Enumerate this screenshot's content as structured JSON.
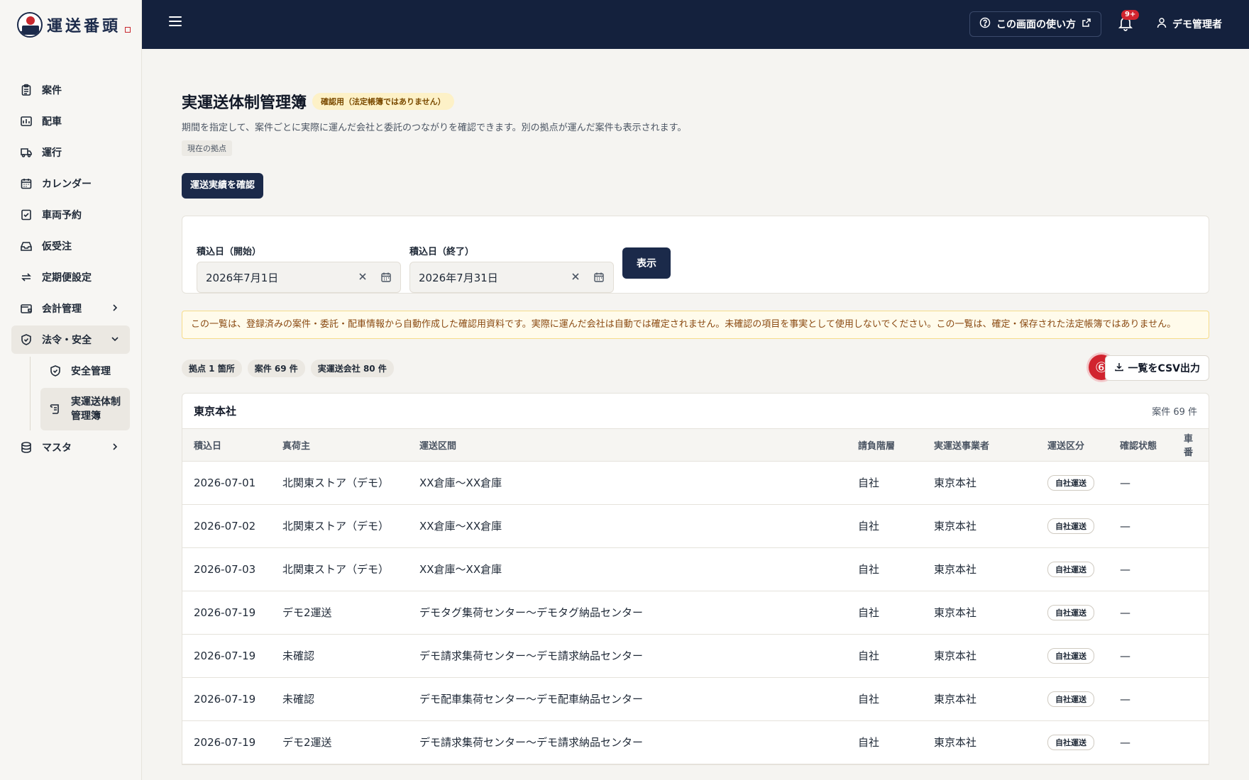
{
  "app": {
    "logo_text": "運送番頭"
  },
  "sidebar": {
    "items": [
      {
        "label": "案件",
        "icon": "clipboard-icon"
      },
      {
        "label": "配車",
        "icon": "chart-icon"
      },
      {
        "label": "運行",
        "icon": "truck-icon"
      },
      {
        "label": "カレンダー",
        "icon": "calendar-icon"
      },
      {
        "label": "車両予約",
        "icon": "check-calendar-icon"
      },
      {
        "label": "仮受注",
        "icon": "inbox-icon"
      },
      {
        "label": "定期便設定",
        "icon": "repeat-icon"
      },
      {
        "label": "会計管理",
        "icon": "wallet-icon"
      },
      {
        "label": "法令・安全",
        "icon": "shield-icon"
      },
      {
        "label": "マスタ",
        "icon": "database-icon"
      }
    ],
    "sub_items": [
      {
        "label": "安全管理"
      },
      {
        "label": "実運送体制管理簿"
      }
    ]
  },
  "topbar": {
    "help_label": "この画面の使い方",
    "notification_badge": "9+",
    "user_name": "デモ管理者"
  },
  "page": {
    "title": "実運送体制管理簿",
    "title_badge": "確認用（法定帳簿ではありません）",
    "description": "期間を指定して、案件ごとに実際に運んだ会社と委託のつながりを確認できます。別の拠点が運んだ案件も表示されます。",
    "scope_tag": "現在の拠点",
    "primary_button": "運送実績を確認"
  },
  "filter": {
    "start_label": "積込日（開始）",
    "start_value": "2026年7月1日",
    "end_label": "積込日（終了）",
    "end_value": "2026年7月31日",
    "show_button": "表示"
  },
  "notice": "この一覧は、登録済みの案件・委託・配車情報から自動作成した確認用資料です。実際に運んだ会社は自動では確定されません。未確認の項目を事実として使用しないでください。この一覧は、確定・保存された法定帳簿ではありません。",
  "stats": {
    "bases": "拠点 1 箇所",
    "cases": "案件 69 件",
    "carriers": "実運送会社 80 件"
  },
  "step_marker": "⑥",
  "csv_button": "一覧をCSV出力",
  "table": {
    "branch_name": "東京本社",
    "branch_count": "案件 69 件",
    "columns": [
      "積込日",
      "真荷主",
      "運送区間",
      "請負階層",
      "実運送事業者",
      "運送区分",
      "確認状態",
      "車番"
    ],
    "rows": [
      [
        "2026-07-01",
        "北関東ストア（デモ）",
        "XX倉庫～XX倉庫",
        "自社",
        "東京本社",
        "自社運送",
        "—",
        ""
      ],
      [
        "2026-07-02",
        "北関東ストア（デモ）",
        "XX倉庫～XX倉庫",
        "自社",
        "東京本社",
        "自社運送",
        "—",
        ""
      ],
      [
        "2026-07-03",
        "北関東ストア（デモ）",
        "XX倉庫～XX倉庫",
        "自社",
        "東京本社",
        "自社運送",
        "—",
        ""
      ],
      [
        "2026-07-19",
        "デモ2運送",
        "デモタグ集荷センター～デモタグ納品センター",
        "自社",
        "東京本社",
        "自社運送",
        "—",
        ""
      ],
      [
        "2026-07-19",
        "未確認",
        "デモ請求集荷センター～デモ請求納品センター",
        "自社",
        "東京本社",
        "自社運送",
        "—",
        ""
      ],
      [
        "2026-07-19",
        "未確認",
        "デモ配車集荷センター～デモ配車納品センター",
        "自社",
        "東京本社",
        "自社運送",
        "—",
        ""
      ],
      [
        "2026-07-19",
        "デモ2運送",
        "デモ請求集荷センター～デモ請求納品センター",
        "自社",
        "東京本社",
        "自社運送",
        "—",
        ""
      ]
    ]
  }
}
